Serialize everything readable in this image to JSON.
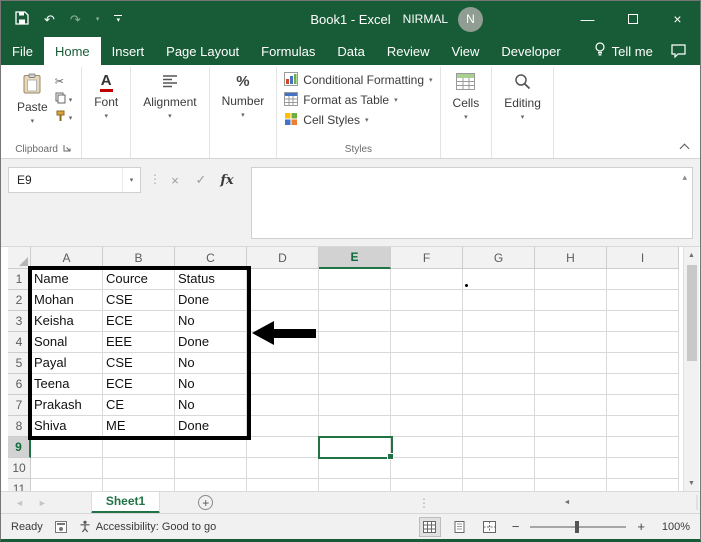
{
  "titlebar": {
    "title": "Book1 - Excel",
    "user_name": "NIRMAL",
    "avatar_initial": "N"
  },
  "tabs": {
    "items": [
      "File",
      "Home",
      "Insert",
      "Page Layout",
      "Formulas",
      "Data",
      "Review",
      "View",
      "Developer"
    ],
    "active": "Home",
    "tell_me": "Tell me"
  },
  "ribbon": {
    "paste_label": "Paste",
    "clipboard_group_label": "Clipboard",
    "font_label": "Font",
    "font_glyph": "A",
    "alignment_label": "Alignment",
    "number_label": "Number",
    "number_glyph": "%",
    "conditional_formatting_label": "Conditional Formatting",
    "format_as_table_label": "Format as Table",
    "cell_styles_label": "Cell Styles",
    "styles_group_label": "Styles",
    "cells_label": "Cells",
    "editing_label": "Editing"
  },
  "formula_bar": {
    "name_box": "E9",
    "fx_label": "fx"
  },
  "sheet": {
    "columns": [
      "A",
      "B",
      "C",
      "D",
      "E",
      "F",
      "G",
      "H",
      "I"
    ],
    "rows": [
      "1",
      "2",
      "3",
      "4",
      "5",
      "6",
      "7",
      "8",
      "9",
      "10",
      "11"
    ],
    "selected_cell": "E9",
    "selected_column": "E",
    "selected_row": "9",
    "highlighted_range": "A1:C8",
    "cells": {
      "A1": "Name",
      "B1": "Cource",
      "C1": "Status",
      "A2": "Mohan",
      "B2": "CSE",
      "C2": "Done",
      "A3": "Keisha",
      "B3": "ECE",
      "C3": "No",
      "A4": "Sonal",
      "B4": "EEE",
      "C4": "Done",
      "A5": "Payal",
      "B5": "CSE",
      "C5": "No",
      "A6": "Teena",
      "B6": "ECE",
      "C6": "No",
      "A7": "Prakash",
      "B7": "CE",
      "C7": "No",
      "A8": "Shiva",
      "B8": "ME",
      "C8": "Done"
    }
  },
  "sheet_tabs": {
    "active": "Sheet1"
  },
  "status_bar": {
    "ready": "Ready",
    "accessibility": "Accessibility: Good to go",
    "zoom_level": "100%"
  },
  "glyphs": {
    "undo": "↶",
    "redo": "↷",
    "chevron_down": "▾",
    "chevron_up": "▴",
    "minimize": "—",
    "close": "×",
    "cut": "✂",
    "cancel": "×",
    "enter": "✓",
    "dots_vertical": "⋮",
    "scroll_up": "▲",
    "scroll_down": "▼",
    "scroll_left": "◄",
    "scroll_right": "►",
    "zoom_minus": "−",
    "zoom_plus": "+",
    "add_sheet": "+"
  },
  "colors": {
    "excel_green_dark": "#185C37",
    "excel_green": "#217346",
    "annotation_black": "#000000",
    "underline_red": "#c00000"
  }
}
